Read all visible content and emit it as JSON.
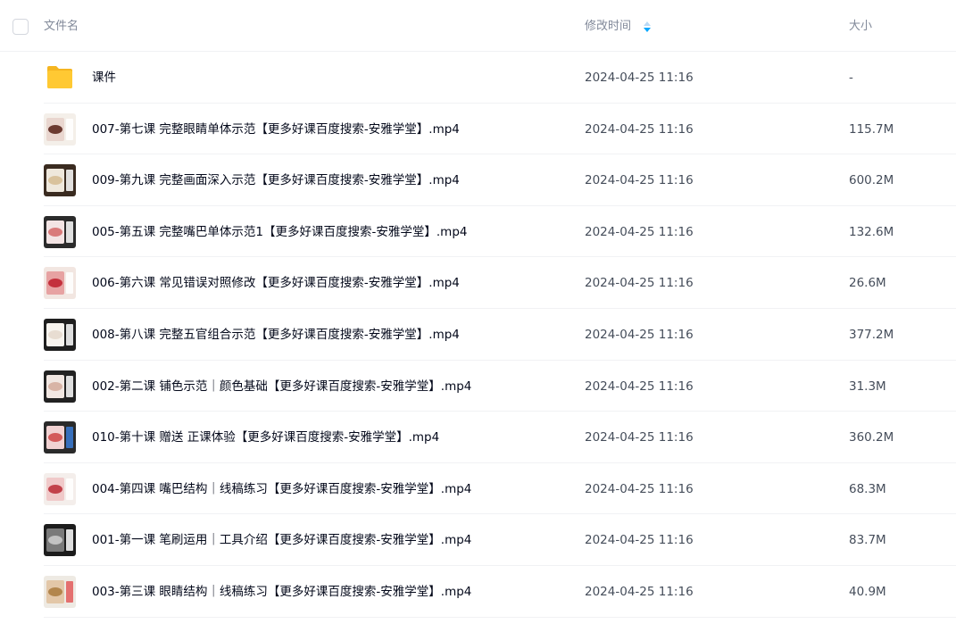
{
  "header": {
    "name_label": "文件名",
    "time_label": "修改时间",
    "size_label": "大小",
    "sort_icon": "sort-icon",
    "sort_color": "#06a7ff"
  },
  "rows": [
    {
      "name": "课件",
      "time": "2024-04-25 11:16",
      "size": "-",
      "icon": "folder-icon"
    },
    {
      "name": "007-第七课 完整眼睛单体示范【更多好课百度搜索-安雅学堂】.mp4",
      "time": "2024-04-25 11:16",
      "size": "115.7M",
      "icon": "video-thumbnail"
    },
    {
      "name": "009-第九课 完整画面深入示范【更多好课百度搜索-安雅学堂】.mp4",
      "time": "2024-04-25 11:16",
      "size": "600.2M",
      "icon": "video-thumbnail"
    },
    {
      "name": "005-第五课 完整嘴巴单体示范1【更多好课百度搜索-安雅学堂】.mp4",
      "time": "2024-04-25 11:16",
      "size": "132.6M",
      "icon": "video-thumbnail"
    },
    {
      "name": "006-第六课 常见错误对照修改【更多好课百度搜索-安雅学堂】.mp4",
      "time": "2024-04-25 11:16",
      "size": "26.6M",
      "icon": "video-thumbnail"
    },
    {
      "name": "008-第八课 完整五官组合示范【更多好课百度搜索-安雅学堂】.mp4",
      "time": "2024-04-25 11:16",
      "size": "377.2M",
      "icon": "video-thumbnail"
    },
    {
      "name": "002-第二课 铺色示范｜颜色基础【更多好课百度搜索-安雅学堂】.mp4",
      "time": "2024-04-25 11:16",
      "size": "31.3M",
      "icon": "video-thumbnail"
    },
    {
      "name": "010-第十课 赠送 正课体验【更多好课百度搜索-安雅学堂】.mp4",
      "time": "2024-04-25 11:16",
      "size": "360.2M",
      "icon": "video-thumbnail"
    },
    {
      "name": "004-第四课 嘴巴结构｜线稿练习【更多好课百度搜索-安雅学堂】.mp4",
      "time": "2024-04-25 11:16",
      "size": "68.3M",
      "icon": "video-thumbnail"
    },
    {
      "name": "001-第一课 笔刷运用｜工具介绍【更多好课百度搜索-安雅学堂】.mp4",
      "time": "2024-04-25 11:16",
      "size": "83.7M",
      "icon": "video-thumbnail"
    },
    {
      "name": "003-第三课 眼睛结构｜线稿练习【更多好课百度搜索-安雅学堂】.mp4",
      "time": "2024-04-25 11:16",
      "size": "40.9M",
      "icon": "video-thumbnail"
    }
  ],
  "colors": {
    "folder": "#ffc933",
    "text_primary": "#03081a",
    "text_secondary": "#454d5a",
    "header_text": "#818999"
  }
}
